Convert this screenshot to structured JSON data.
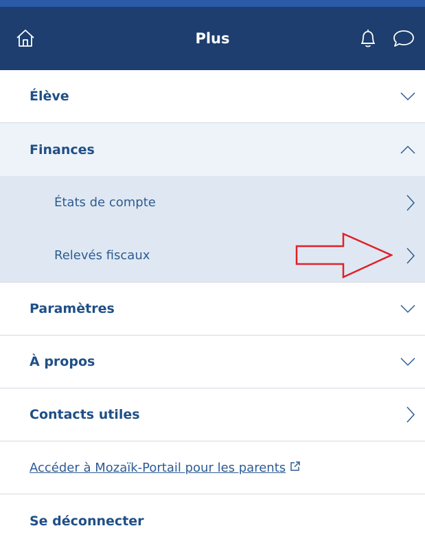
{
  "header": {
    "title": "Plus",
    "left_icon": "home-icon",
    "right_icons": [
      "bell-icon",
      "chat-bubble-icon"
    ],
    "colors": {
      "bar": "#1d3e6e",
      "top_strip": "#2a5aa8"
    }
  },
  "menu": {
    "items": [
      {
        "label": "Élève",
        "state": "collapsed",
        "icon": "chevron-down-icon"
      },
      {
        "label": "Finances",
        "state": "expanded",
        "icon": "chevron-up-icon",
        "children": [
          {
            "label": "États de compte",
            "icon": "chevron-right-icon"
          },
          {
            "label": "Relevés fiscaux",
            "icon": "chevron-right-icon",
            "annotation": "red-arrow-pointer"
          }
        ]
      },
      {
        "label": "Paramètres",
        "state": "collapsed",
        "icon": "chevron-down-icon"
      },
      {
        "label": "À propos",
        "state": "collapsed",
        "icon": "chevron-down-icon"
      },
      {
        "label": "Contacts utiles",
        "icon": "chevron-right-icon"
      }
    ]
  },
  "portal_link": {
    "label": "Accéder à Mozaïk-Portail pour les parents",
    "icon": "external-link-icon"
  },
  "logout": {
    "label": "Se déconnecter"
  },
  "colors": {
    "text_primary": "#1f4f86",
    "expanded_bg": "#eef3f9",
    "sub_bg": "#dfe8f2",
    "annotation": "#e0202a"
  }
}
